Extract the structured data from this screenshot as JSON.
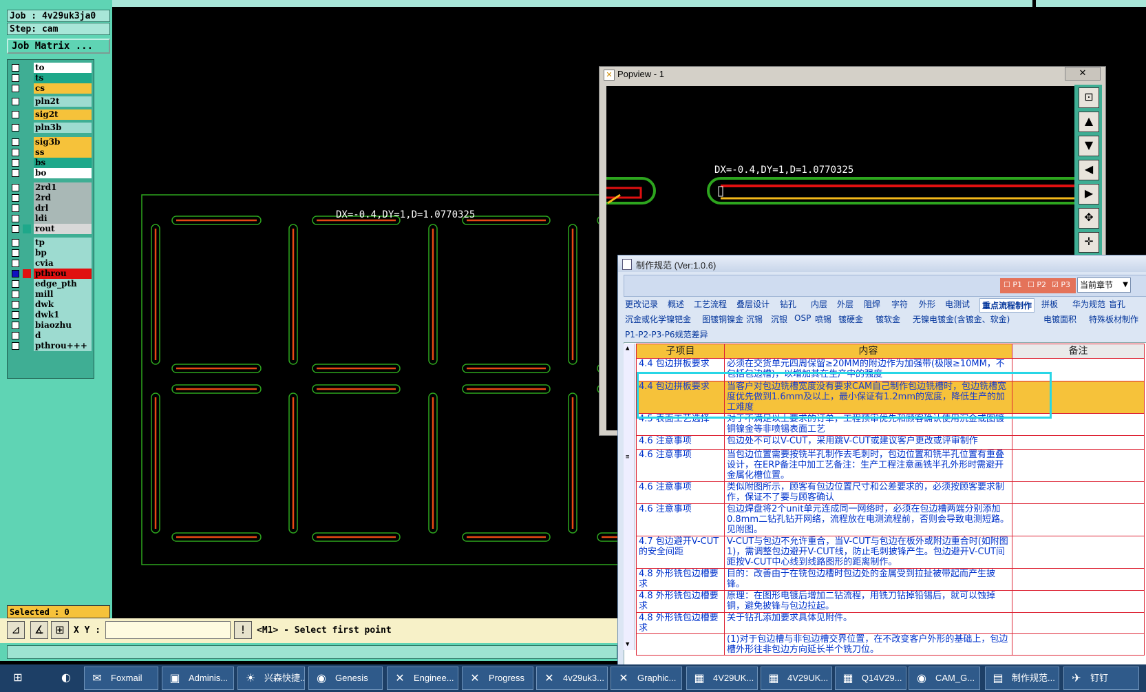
{
  "job": {
    "job_label": "Job : 4v29uk3ja0",
    "step_label": "Step: cam",
    "matrix_button": "Job Matrix ..."
  },
  "layers": [
    {
      "name": "to",
      "color": "#ffffff"
    },
    {
      "name": "ts",
      "color": "#1ea88a"
    },
    {
      "name": "cs",
      "color": "#f6c23a"
    },
    {
      "name": "pln2t",
      "color": "#9ddbd0"
    },
    {
      "name": "sig2t",
      "color": "#f6c23a"
    },
    {
      "name": "pln3b",
      "color": "#9ddbd0"
    },
    {
      "name": "sig3b",
      "color": "#f6c23a"
    },
    {
      "name": "ss",
      "color": "#f6c23a"
    },
    {
      "name": "bs",
      "color": "#1ea88a"
    },
    {
      "name": "bo",
      "color": "#ffffff"
    },
    {
      "name": "2rd1",
      "color": "#a9b8b6"
    },
    {
      "name": "2rd",
      "color": "#a9b8b6"
    },
    {
      "name": "drl",
      "color": "#a9b8b6"
    },
    {
      "name": "ldi",
      "color": "#a9b8b6"
    },
    {
      "name": "rout",
      "color": "#d8d8d8"
    },
    {
      "name": "tp",
      "color": "#9ddbd0"
    },
    {
      "name": "bp",
      "color": "#9ddbd0"
    },
    {
      "name": "cvia",
      "color": "#9ddbd0"
    },
    {
      "name": "pthrou",
      "color": "#e01010"
    },
    {
      "name": "edge_pth",
      "color": "#9ddbd0"
    },
    {
      "name": "mill",
      "color": "#9ddbd0"
    },
    {
      "name": "dwk",
      "color": "#9ddbd0"
    },
    {
      "name": "dwk1",
      "color": "#9ddbd0"
    },
    {
      "name": "biaozhu",
      "color": "#9ddbd0"
    },
    {
      "name": "d",
      "color": "#9ddbd0"
    },
    {
      "name": "pthrou+++",
      "color": "#9ddbd0"
    }
  ],
  "selected_label": "Selected : 0",
  "canvas": {
    "measure_text": "DX=-0.4,DY=1,D=1.0770325"
  },
  "command": {
    "xy_label": "X Y :",
    "xy_value": "",
    "prompt": "<M1> - Select first point"
  },
  "popview": {
    "title": "Popview - 1",
    "measure_text": "DX=-0.4,DY=1,D=1.0770325",
    "close_glyph": "✕"
  },
  "spec": {
    "title": "制作规范 (Ver:1.0.6)",
    "pages": [
      "P1",
      "P2",
      "P3"
    ],
    "chapter_select": "当前章节",
    "tabs_row1": [
      "更改记录",
      "概述",
      "工艺流程",
      "叠层设计",
      "钻孔",
      "内层",
      "外层",
      "阻焊",
      "字符",
      "外形",
      "电测试",
      "重点流程制作",
      "拼板",
      "华为规范",
      "盲孔"
    ],
    "active_tab": "重点流程制作",
    "tabs_row2": [
      "沉金或化学镍钯金",
      "图镀铜镍金",
      "沉锡",
      "沉银",
      "OSP",
      "喷锡",
      "镀硬金",
      "镀软金",
      "无镍电镀金(含镀金、软金)",
      "电镀面积",
      "特殊板材制作"
    ],
    "tabs_row3": [
      "P1-P2-P3-P6规范差异"
    ],
    "headers": [
      "子项目",
      "内容",
      "备注"
    ],
    "rows": [
      {
        "item": "4.4 包边拼板要求",
        "content": "必须在交货单元四周保留≥20MM的附边作为加强带(极限≥10MM，不包括包边槽)，以增加其在生产中的强度",
        "note": ""
      },
      {
        "item": "4.4 包边拼板要求",
        "content": "当客户对包边铣槽宽度没有要求CAM自己制作包边铣槽时，包边铣槽宽度优先做到1.6mm及以上，最小保证有1.2mm的宽度，降低生产的加工难度",
        "note": ""
      },
      {
        "item": "4.5 表面工艺选择",
        "content": "对于不满足以上要求的订单，工程预审优先和顾客确认使用沉金或图镀铜镍金等非喷锡表面工艺",
        "note": ""
      },
      {
        "item": "4.6 注意事项",
        "content": "包边处不可以V-CUT，采用跳V-CUT或建议客户更改或评审制作",
        "note": ""
      },
      {
        "item": "4.6 注意事项",
        "content": "当包边位置需要按铣半孔制作去毛刺时，包边位置和铣半孔位置有重叠设计，在ERP备注中加工艺备注：生产工程注意画铣半孔外形时需避开金属化槽位置。",
        "note": ""
      },
      {
        "item": "4.6 注意事项",
        "content": "类似附图所示，顾客有包边位置尺寸和公差要求的，必须按顾客要求制作，保证不了要与顾客确认",
        "note": ""
      },
      {
        "item": "4.6 注意事项",
        "content": "包边焊盘将2个unit单元连成同一网络时，必须在包边槽两端分别添加0.8mm二钻孔钻开网络，流程放在电测流程前，否则会导致电测短路。见附图。",
        "note": ""
      },
      {
        "item": "4.7 包边避开V-CUT的安全间距",
        "content": "V-CUT与包边不允许重合，当V-CUT与包边在板外或附边重合时(如附图1)，需调整包边避开V-CUT线，防止毛刺披锋产生。包边避开V-CUT间距按V-CUT中心线到线路图形的距离制作。",
        "note": ""
      },
      {
        "item": "4.8 外形铣包边槽要求",
        "content": "目的：改善由于在铣包边槽时包边处的金属受到拉扯被带起而产生披锋。",
        "note": ""
      },
      {
        "item": "4.8 外形铣包边槽要求",
        "content": "原理：在图形电镀后增加二钻流程，用铣刀钻掉铅锡后，就可以蚀掉铜，避免披锋与包边拉起。",
        "note": ""
      },
      {
        "item": "4.8 外形铣包边槽要求",
        "content": "关于钻孔添加要求具体见附件。",
        "note": ""
      },
      {
        "item": "",
        "content": "(1)对于包边槽与非包边槽交界位置，在不改变客户外形的基础上，包边槽外形往非包边方向延长半个铣刀位。",
        "note": ""
      }
    ]
  },
  "taskbar": [
    {
      "label": "",
      "icon": "windows-start-icon"
    },
    {
      "label": "",
      "icon": "browser-icon"
    },
    {
      "label": "Foxmail",
      "icon": "foxmail-icon"
    },
    {
      "label": "Adminis...",
      "icon": "save-disk-icon"
    },
    {
      "label": "兴森快捷...",
      "icon": "shell-icon"
    },
    {
      "label": "Genesis",
      "icon": "genesis-icon"
    },
    {
      "label": "Enginee...",
      "icon": "x-window-icon"
    },
    {
      "label": "Progress",
      "icon": "x-window-icon"
    },
    {
      "label": "4v29uk3...",
      "icon": "x-window-icon"
    },
    {
      "label": "Graphic...",
      "icon": "x-window-icon"
    },
    {
      "label": "4V29UK...",
      "icon": "excel-icon"
    },
    {
      "label": "4V29UK...",
      "icon": "excel-icon"
    },
    {
      "label": "Q14V29...",
      "icon": "excel-icon"
    },
    {
      "label": "CAM_G...",
      "icon": "genesis-icon"
    },
    {
      "label": "制作规范...",
      "icon": "document-icon"
    },
    {
      "label": "钉钉",
      "icon": "dingtalk-icon"
    }
  ]
}
